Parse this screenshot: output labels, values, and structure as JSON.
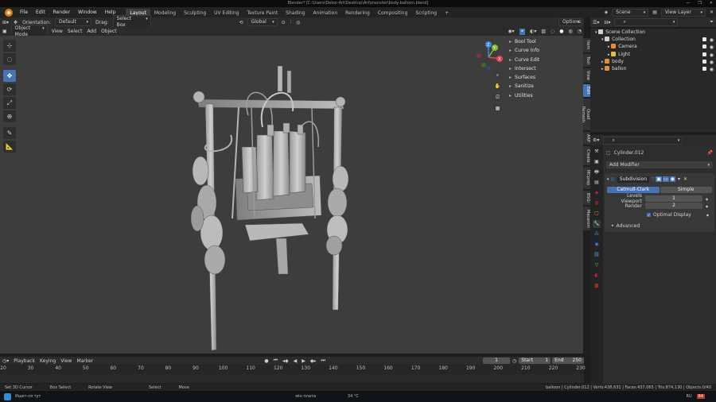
{
  "window": {
    "title": "Blender* [C:\\Users\\Dekor-Art\\Desktop\\Art\\monster\\body-balloon.blend]",
    "controls": [
      "—",
      "❐",
      "✕"
    ]
  },
  "menu": [
    "File",
    "Edit",
    "Render",
    "Window",
    "Help"
  ],
  "workspaces": [
    "Layout",
    "Modeling",
    "Sculpting",
    "UV Editing",
    "Texture Paint",
    "Shading",
    "Animation",
    "Rendering",
    "Compositing",
    "Scripting"
  ],
  "active_workspace": "Layout",
  "scene": {
    "label": "Scene",
    "view_layer": "View Layer"
  },
  "viewport_header": {
    "orientation_label": "Orientation:",
    "orientation_value": "Default",
    "drag_label": "Drag:",
    "drag_value": "Select Box",
    "transform_orientation": "Global",
    "options": "Options"
  },
  "viewport_menu": {
    "mode": "Object Mode",
    "items": [
      "View",
      "Select",
      "Add",
      "Object"
    ]
  },
  "tools": [
    "cursor",
    "select",
    "move",
    "rotate",
    "scale",
    "transform",
    "annotate",
    "measure"
  ],
  "n_panel_tabs": [
    "Item",
    "Tool",
    "View",
    "Edit",
    "Quad Remesh",
    "ARP",
    "Create",
    "MCprep",
    "BSGi",
    "Macaroni"
  ],
  "n_panel_active": "Edit",
  "addon_items": [
    "Bool Tool",
    "Curve Info",
    "Curve Edit",
    "Intersect",
    "Surfaces",
    "Sanitize",
    "Utilities"
  ],
  "gizmo": {
    "x": "X",
    "y": "Y",
    "z": "Z"
  },
  "timeline": {
    "menus": [
      "Playback",
      "Keying",
      "View",
      "Marker"
    ],
    "current_frame": "1",
    "start_label": "Start",
    "start": "1",
    "end_label": "End",
    "end": "250",
    "ticks": [
      "20",
      "30",
      "40",
      "50",
      "60",
      "70",
      "80",
      "90",
      "100",
      "110",
      "120",
      "130",
      "140",
      "150",
      "160",
      "170",
      "180",
      "190",
      "200",
      "210",
      "220",
      "230"
    ]
  },
  "status_bar": {
    "hints": [
      "Set 3D Cursor",
      "Box Select",
      "Rotate View",
      "Select",
      "Move"
    ],
    "stats": "balloon | Cylinder.012 | Verts:438,631 | Faces:437,065 | Tris:874,130 | Objects:0/40"
  },
  "taskbar": {
    "left_text": "Ищет-ся тут",
    "weather": "34 °C",
    "weather_desc": "мін плата",
    "lang": "RU",
    "badge": "64"
  },
  "outliner": {
    "rows": [
      {
        "name": "Scene Collection",
        "indent": 0,
        "color": "#cfcfcf"
      },
      {
        "name": "Collection",
        "indent": 1,
        "color": "#cfcfcf"
      },
      {
        "name": "Camera",
        "indent": 2,
        "color": "#e48b3c"
      },
      {
        "name": "Light",
        "indent": 2,
        "color": "#e4bf3c"
      },
      {
        "name": "body",
        "indent": 1,
        "color": "#e48b3c"
      },
      {
        "name": "ballon",
        "indent": 1,
        "color": "#e48b3c"
      }
    ]
  },
  "properties": {
    "object_name": "Cylinder.012",
    "add_modifier": "Add Modifier",
    "modifier_name": "Subdivision",
    "tab_active": "Catmull-Clark",
    "tab_other": "Simple",
    "levels_viewport_label": "Levels Viewport",
    "levels_viewport": "1",
    "render_label": "Render",
    "render": "2",
    "optimal_display": "Optimal Display",
    "advanced": "Advanced"
  }
}
